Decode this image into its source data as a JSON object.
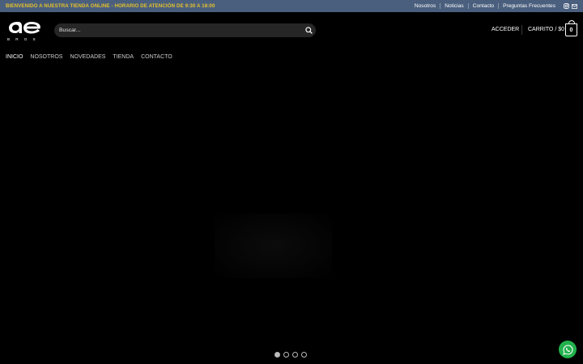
{
  "topbar": {
    "message": "BIENVENIDO A NUESTRA TIENDA ONLINE - HORARIO DE ATENCIÓN DE 9:30 A 18:00",
    "links": [
      "Nosotros",
      "Noticias",
      "Contacto",
      "Preguntas Frecuentes"
    ],
    "icons": [
      "instagram-icon",
      "mail-icon"
    ],
    "bg_color": "#4a5f7e",
    "message_color": "#e6c22a"
  },
  "header": {
    "search_placeholder": "Buscar...",
    "login_label": "ACCEDER",
    "cart_label": "CARRITO / $0",
    "cart_count": "0"
  },
  "nav": {
    "items": [
      "INICIO",
      "NOSOTROS",
      "NOVEDADES",
      "TIENDA",
      "CONTACTO"
    ],
    "active": "INICIO"
  },
  "slider": {
    "slides": 4,
    "active_index": 0
  },
  "whatsapp": {
    "color": "#22b14c",
    "icon": "whatsapp-icon"
  }
}
